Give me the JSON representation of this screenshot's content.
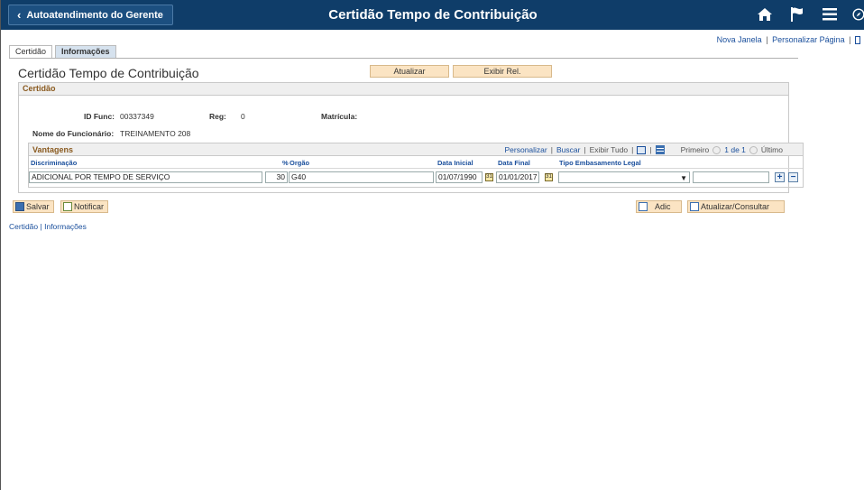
{
  "header": {
    "back_label": "Autoatendimento do Gerente",
    "title": "Certidão Tempo de Contribuição",
    "icons": [
      "home-icon",
      "flag-icon",
      "menu-icon",
      "compass-icon"
    ]
  },
  "toplinks": {
    "new_window": "Nova Janela",
    "sep": "|",
    "personalize_page": "Personalizar Página",
    "sep2": "|"
  },
  "tabs": [
    {
      "label": "Certidão"
    },
    {
      "label": "Informações"
    }
  ],
  "page": {
    "title": "Certidão Tempo de Contribuição",
    "update_label": "Atualizar",
    "report_label": "Exibir Rel."
  },
  "certidao": {
    "group_title": "Certidão",
    "id_func_label": "ID Func:",
    "id_func_value": "00337349",
    "reg_label": "Reg:",
    "reg_value": "0",
    "matricula_label": "Matrícula:",
    "nome_label": "Nome do Funcionário:",
    "nome_value": "TREINAMENTO 208"
  },
  "vantagens": {
    "title": "Vantagens",
    "nav": {
      "personalize": "Personalizar",
      "sep1": "|",
      "search": "Buscar",
      "sep2": "|",
      "show_all": "Exibir Tudo",
      "sep3": "|",
      "sep4": "|",
      "first": "Primeiro",
      "range": "1 de 1",
      "last": "Último"
    },
    "columns": {
      "discriminacao": "Discriminação",
      "percent": "%",
      "orgao": "Orgão",
      "data_inicial": "Data Inicial",
      "data_final": "Data Final",
      "tipo": "Tipo Embasamento Legal"
    },
    "rows": [
      {
        "discriminacao": "ADICIONAL POR TEMPO DE SERVIÇO",
        "percent": "30",
        "orgao": "G40",
        "data_inicial": "01/07/1990",
        "data_final": "01/01/2017",
        "tipo": "",
        "extra": ""
      }
    ],
    "cal_glyph": "31",
    "add_row": "+",
    "remove_row": "−"
  },
  "actions": {
    "save": "Salvar",
    "notify": "Notificar",
    "add": "Adic",
    "update_query": "Atualizar/Consultar"
  },
  "bottom_links": {
    "certidao": "Certidão",
    "sep": "|",
    "informacoes": "Informações"
  },
  "colors": {
    "header_bg": "#0f3d69",
    "link": "#1a4f9c",
    "section_title": "#8a5a1f",
    "button_bg": "#fbe4c3"
  }
}
